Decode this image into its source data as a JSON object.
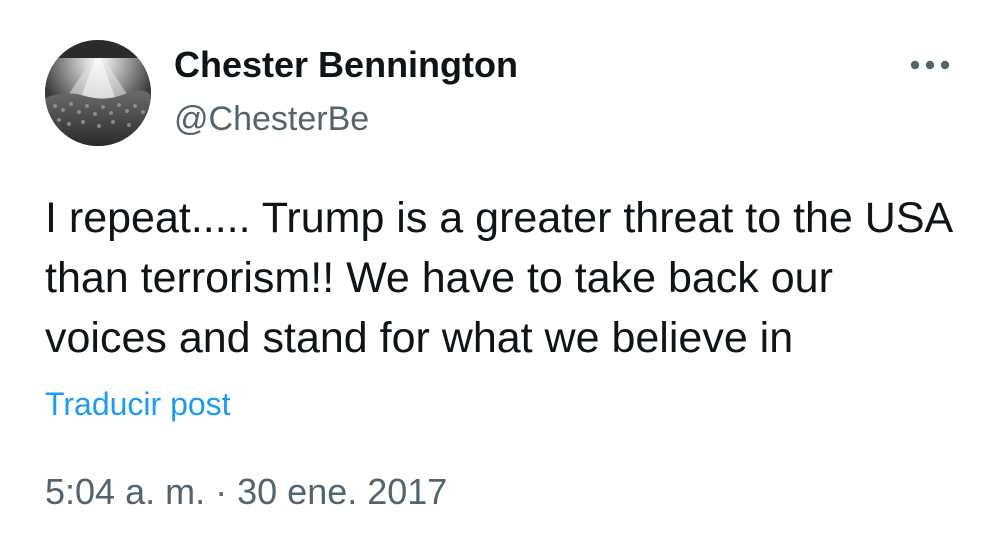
{
  "author": {
    "display_name": "Chester Bennington",
    "handle": "@ChesterBe"
  },
  "post": {
    "text": "I repeat..... Trump is a greater threat to the USA than terrorism!! We have to take back our voices and stand for what we believe in",
    "translate_label": "Traducir post",
    "time": "5:04 a. m.",
    "separator": "·",
    "date": "30 ene. 2017"
  },
  "icons": {
    "more": "more-options-icon",
    "avatar": "avatar-concert-crowd"
  },
  "colors": {
    "text": "#0f1419",
    "secondary": "#536471",
    "link": "#1d9bf0"
  }
}
